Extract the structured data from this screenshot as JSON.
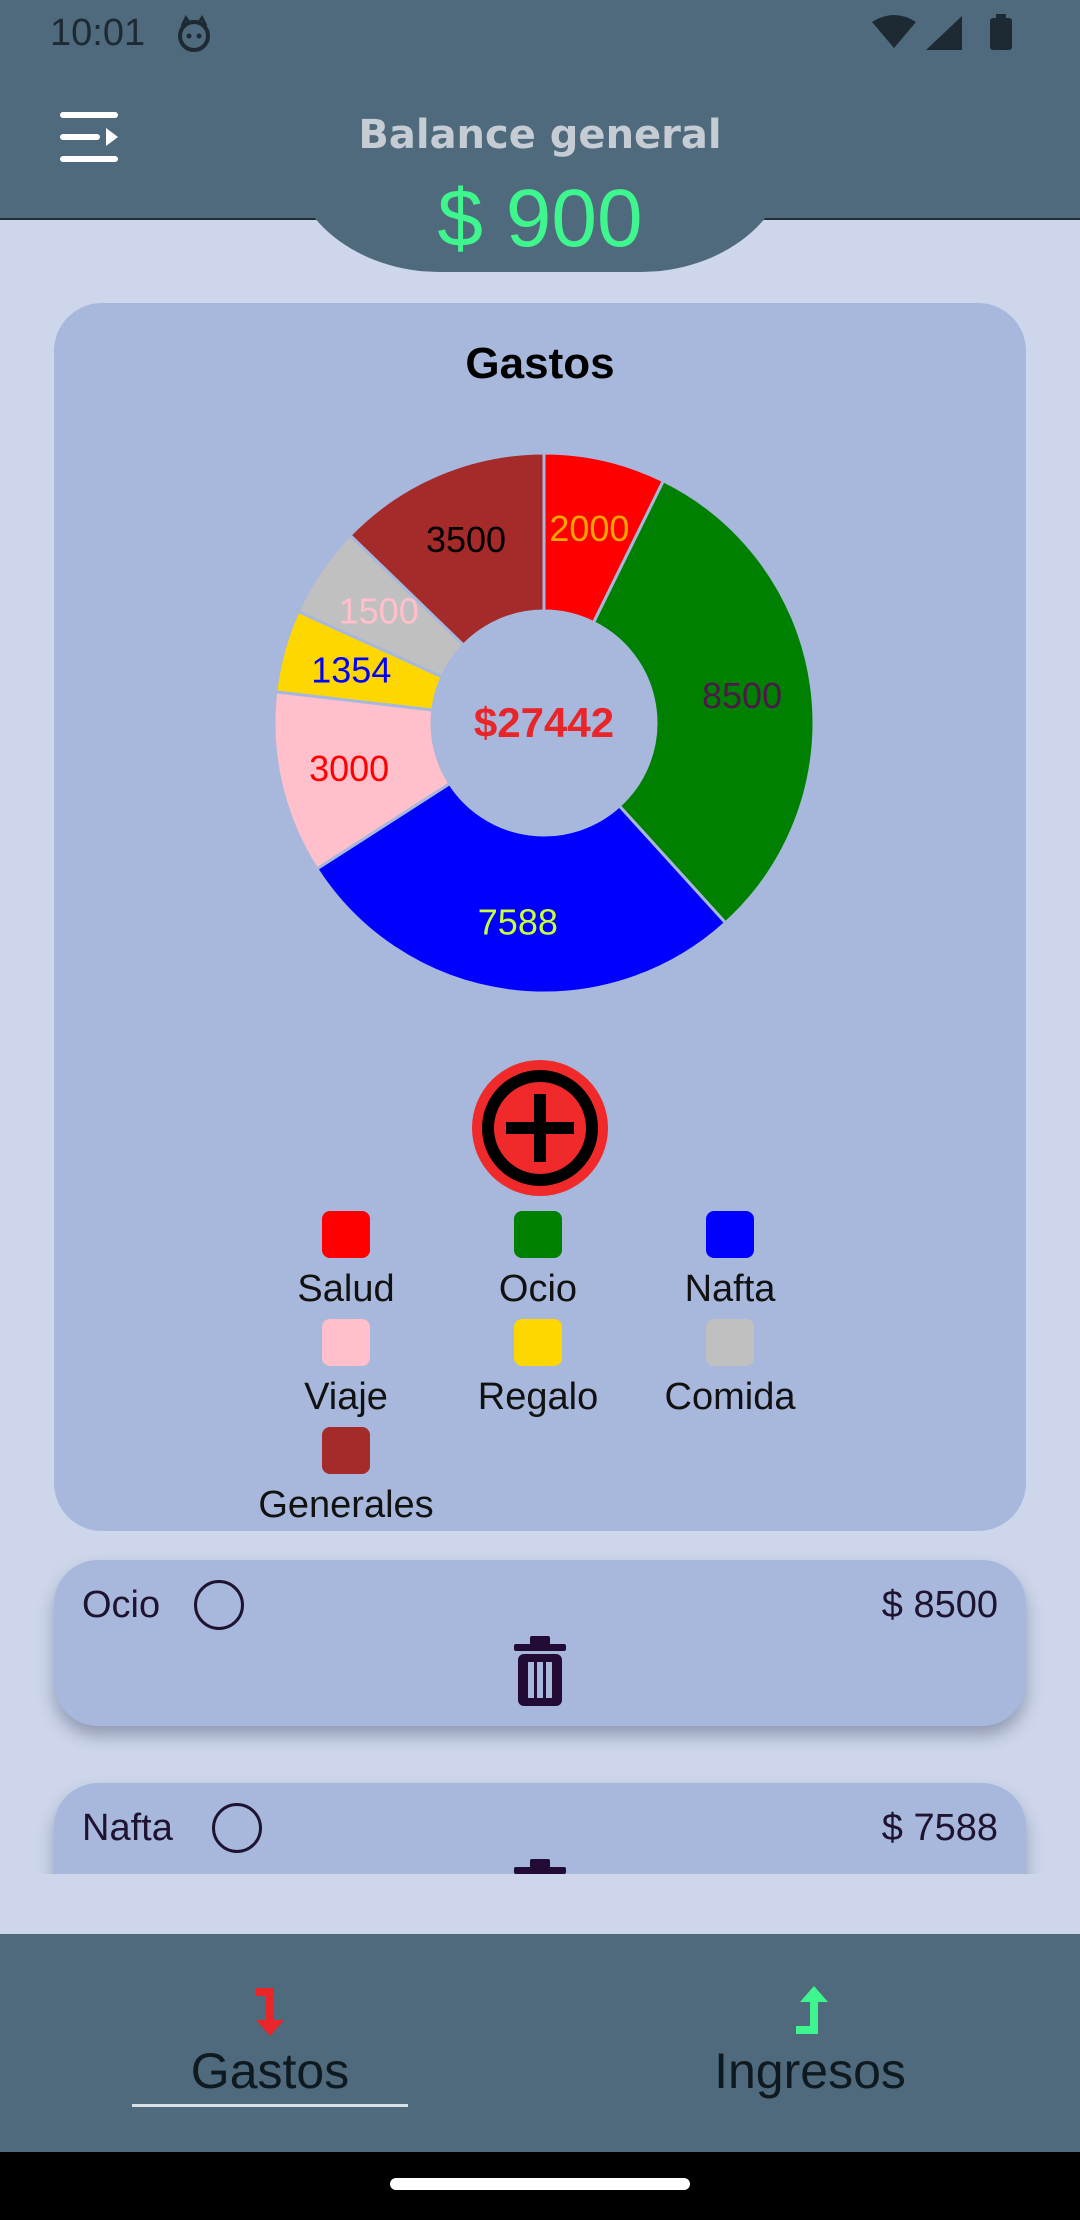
{
  "status_bar": {
    "time": "10:01"
  },
  "header": {
    "balance_label": "Balance general",
    "balance_value": "$ 900"
  },
  "expenses_card": {
    "title": "Gastos",
    "total_label": "$27442"
  },
  "chart_data": {
    "type": "pie",
    "title": "Gastos",
    "center_label": "$27442",
    "categories": [
      "Salud",
      "Ocio",
      "Nafta",
      "Viaje",
      "Regalo",
      "Comida",
      "Generales"
    ],
    "values": [
      2000,
      8500,
      7588,
      3000,
      1354,
      1500,
      3500
    ],
    "colors": [
      "#ff0000",
      "#008000",
      "#0000ff",
      "#ffc0cb",
      "#ffd700",
      "#c0c0c0",
      "#a52a2a"
    ],
    "label_colors": [
      "#ffa500",
      "#4b1a4b",
      "#c8ff3c",
      "#ff0000",
      "#0000ff",
      "#ffc0cb",
      "#000000"
    ],
    "donut": true,
    "legend_position": "bottom"
  },
  "legend": [
    {
      "label": "Salud",
      "color": "#ff0000"
    },
    {
      "label": "Ocio",
      "color": "#008000"
    },
    {
      "label": "Nafta",
      "color": "#0000ff"
    },
    {
      "label": "Viaje",
      "color": "#ffc0cb"
    },
    {
      "label": "Regalo",
      "color": "#ffd700"
    },
    {
      "label": "Comida",
      "color": "#c0c0c0"
    },
    {
      "label": "Generales",
      "color": "#a52a2a"
    }
  ],
  "expenses_list": [
    {
      "category": "Ocio",
      "amount": "$ 8500"
    },
    {
      "category": "Nafta",
      "amount": "$ 7588"
    }
  ],
  "bottom_nav": {
    "tabs": [
      {
        "label": "Gastos",
        "icon": "arrow-down-icon",
        "color": "#e8262a",
        "selected": true
      },
      {
        "label": "Ingresos",
        "icon": "arrow-up-icon",
        "color": "#3ff58e",
        "selected": false
      }
    ]
  }
}
